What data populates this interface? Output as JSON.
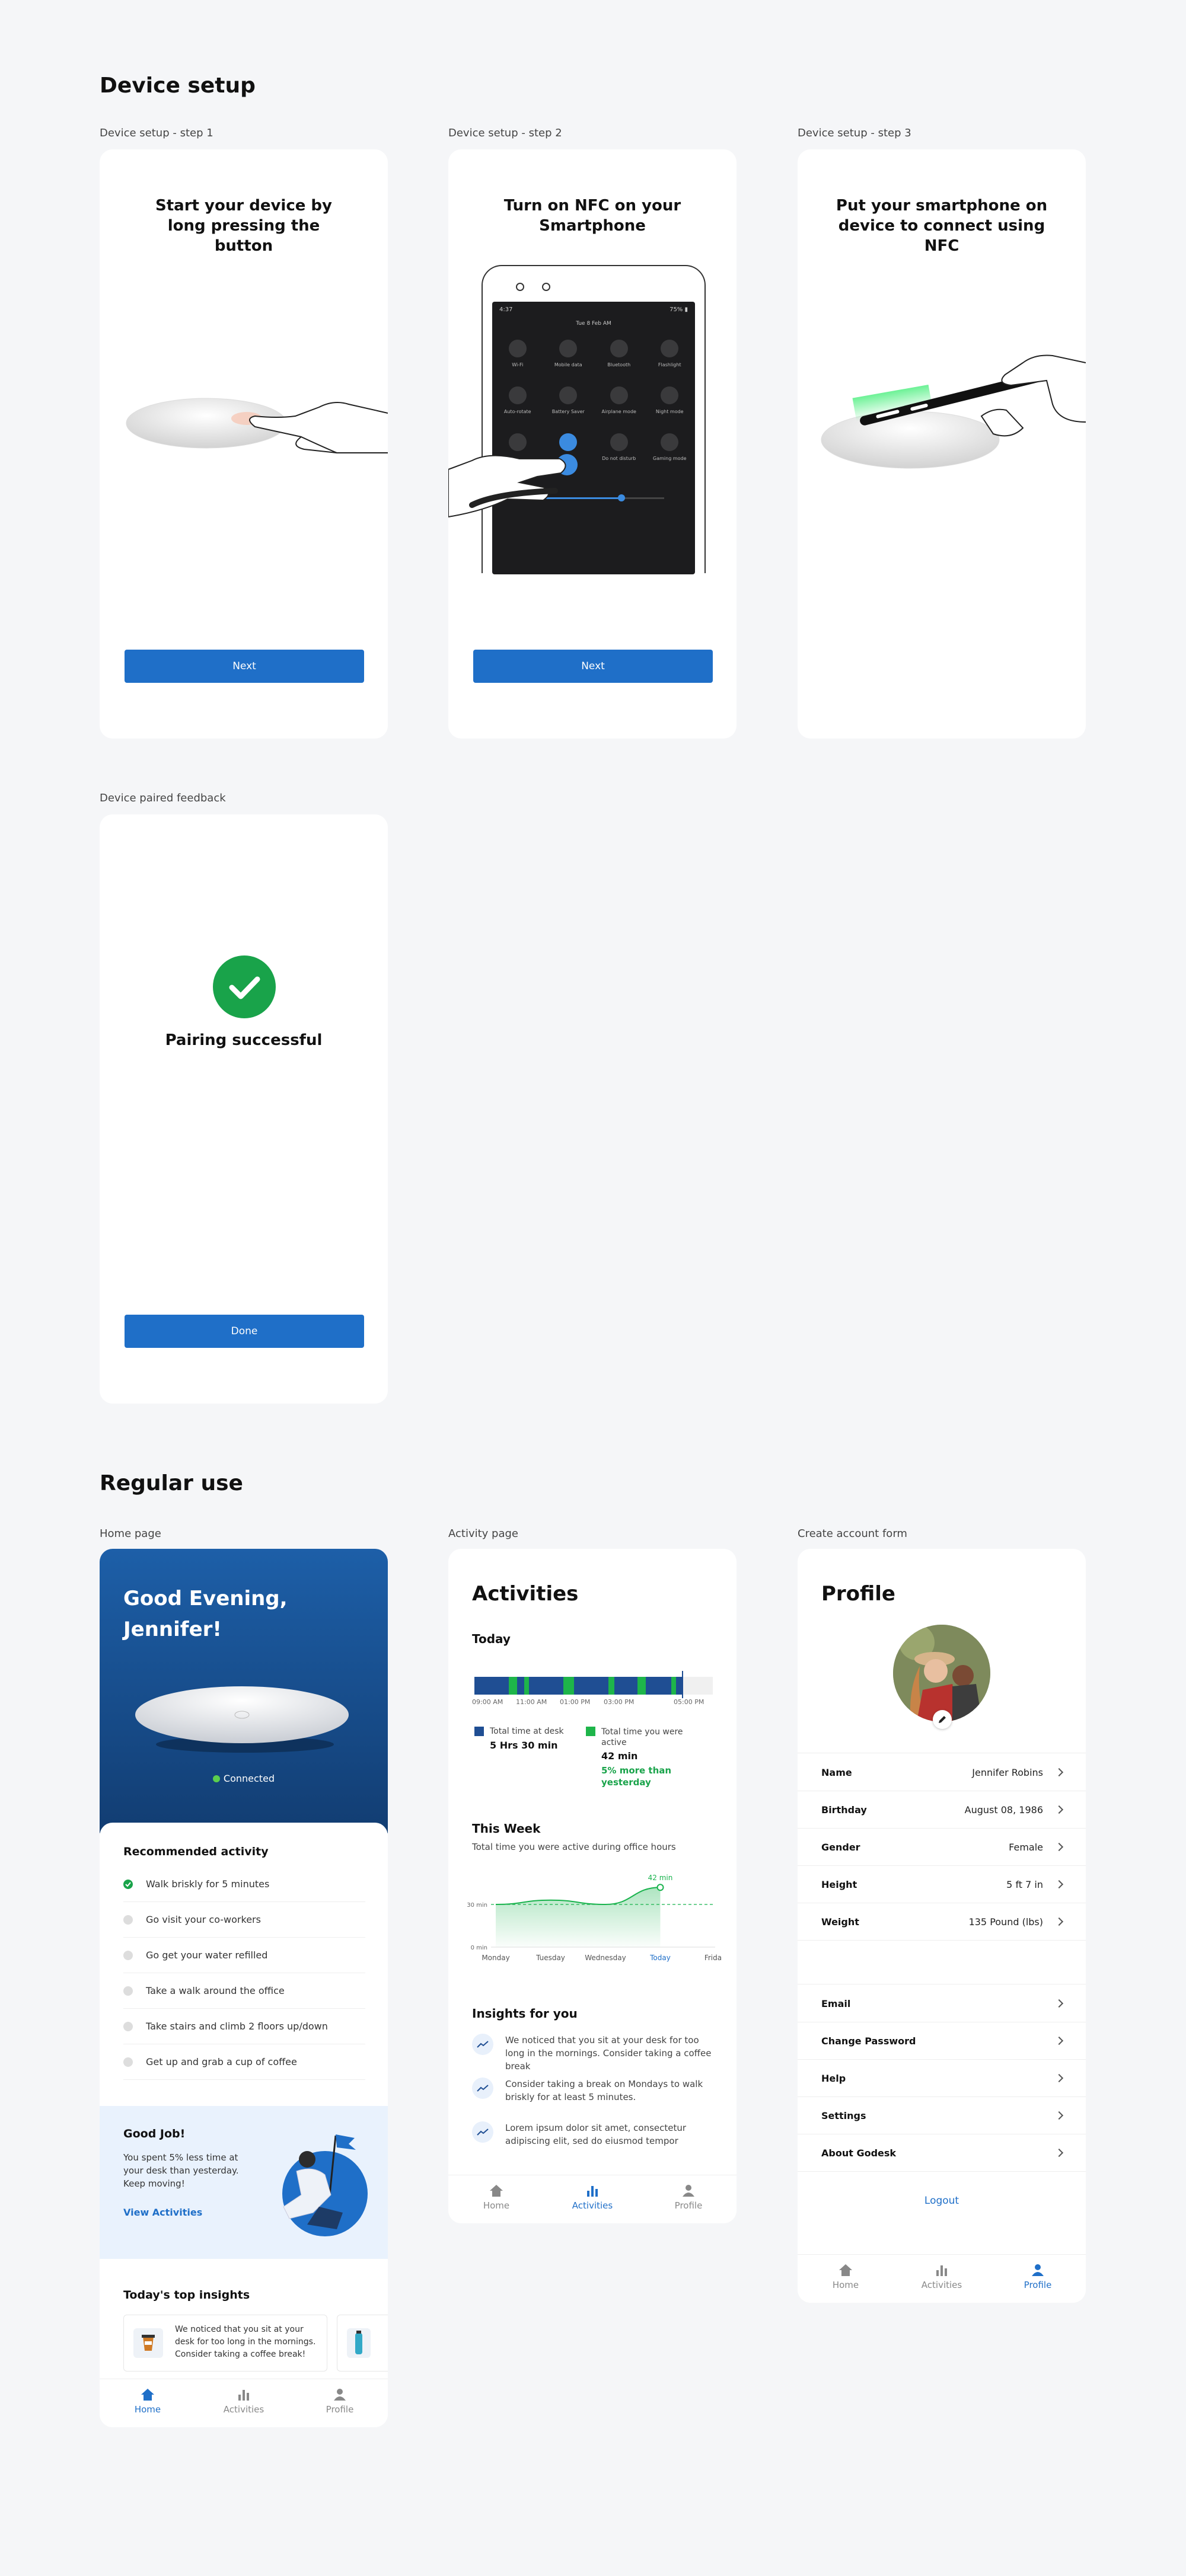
{
  "sections": {
    "setup_title": "Device setup",
    "regular_title": "Regular use"
  },
  "captions": {
    "step1": "Device setup - step 1",
    "step2": "Device setup - step 2",
    "step3": "Device setup - step 3",
    "paired": "Device paired feedback",
    "home": "Home page",
    "activity": "Activity page",
    "account": "Create account form"
  },
  "step1": {
    "title": "Start your device by long pressing the button",
    "button": "Next"
  },
  "step2": {
    "title": "Turn on NFC on your Smartphone",
    "button": "Next",
    "phone": {
      "time": "4:37",
      "battery": "75% ▮",
      "date": "Tue 8 Feb AM",
      "tiles": [
        "Wi-Fi",
        "Mobile data",
        "Bluetooth",
        "Flashlight",
        "Auto-rotate",
        "Battery Saver",
        "Airplane mode",
        "Night mode",
        "",
        "NFC",
        "Do not disturb",
        "Gaming mode"
      ]
    }
  },
  "step3": {
    "title": "Put your smartphone on device to connect using NFC"
  },
  "paired": {
    "title": "Pairing successful",
    "button": "Done"
  },
  "home": {
    "greeting": "Good Evening, Jennifer!",
    "status": "Connected",
    "rec_title": "Recommended activity",
    "rec_items": [
      {
        "label": "Walk briskly for 5 minutes",
        "done": true
      },
      {
        "label": "Go visit your co-workers",
        "done": false
      },
      {
        "label": "Go get your water refilled",
        "done": false
      },
      {
        "label": "Take a walk around the office",
        "done": false
      },
      {
        "label": "Take stairs and climb 2 floors up/down",
        "done": false
      },
      {
        "label": "Get up and grab a cup of coffee",
        "done": false
      }
    ],
    "job_title": "Good Job!",
    "job_text": "You spent 5% less time at your desk than yesterday. Keep moving!",
    "job_link": "View Activities",
    "insights_title": "Today's top insights",
    "insight_card": "We noticed that you sit at your desk for too long in the mornings. Consider taking a coffee break!",
    "nav": [
      "Home",
      "Activities",
      "Profile"
    ]
  },
  "activity": {
    "title": "Activities",
    "today": "Today",
    "timeline_ticks": [
      "09:00 AM",
      "11:00 AM",
      "01:00 PM",
      "03:00 PM",
      "05:00 PM"
    ],
    "desk_label": "Total time at desk",
    "desk_value": "5 Hrs 30 min",
    "active_label": "Total time you were active",
    "active_value": "42 min",
    "active_delta": "5% more than yesterday",
    "week_title": "This Week",
    "week_sub": "Total time you were active during office hours",
    "insights_title": "Insights for you",
    "insights": [
      "We noticed that you sit at your desk for too long in the mornings. Consider taking a coffee break",
      "Consider taking a break on Mondays to walk briskly for at least 5 minutes.",
      "Lorem ipsum dolor sit amet, consectetur adipiscing elit, sed do eiusmod tempor"
    ],
    "nav": [
      "Home",
      "Activities",
      "Profile"
    ]
  },
  "chart_data": {
    "type": "area",
    "categories": [
      "Monday",
      "Tuesday",
      "Wednesday",
      "Today",
      "Friday"
    ],
    "values": [
      30,
      33,
      30,
      42,
      null
    ],
    "y_ticks": [
      "0 min",
      "30 min"
    ],
    "reference_line": 30,
    "point_label": "42 min",
    "ylim": [
      0,
      50
    ],
    "colors": {
      "line": "#19b34d",
      "reference": "#19b34d",
      "today_label": "#1f6fc8"
    }
  },
  "profile": {
    "title": "Profile",
    "rows1": [
      {
        "k": "Name",
        "v": "Jennifer Robins"
      },
      {
        "k": "Birthday",
        "v": "August 08, 1986"
      },
      {
        "k": "Gender",
        "v": "Female"
      },
      {
        "k": "Height",
        "v": "5 ft 7 in"
      },
      {
        "k": "Weight",
        "v": "135 Pound (lbs)"
      }
    ],
    "rows2": [
      "Email",
      "Change Password",
      "Help",
      "Settings",
      "About Godesk"
    ],
    "logout": "Logout",
    "nav": [
      "Home",
      "Activities",
      "Profile"
    ]
  },
  "colors": {
    "primary": "#1f6fc8",
    "success": "#19a34a",
    "header_dark": "#123d72"
  }
}
